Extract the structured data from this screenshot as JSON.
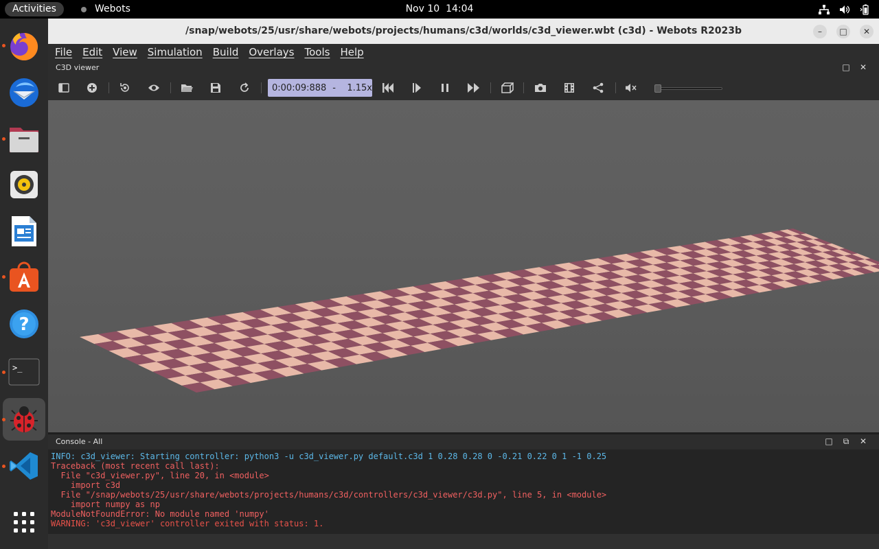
{
  "topbar": {
    "activities": "Activities",
    "app_name": "Webots",
    "date": "Nov 10",
    "time": "14:04"
  },
  "dock": {
    "items": [
      {
        "name": "firefox",
        "running": true
      },
      {
        "name": "thunderbird",
        "running": false
      },
      {
        "name": "files",
        "running": true
      },
      {
        "name": "rhythmbox",
        "running": false
      },
      {
        "name": "libreoffice-writer",
        "running": false
      },
      {
        "name": "app-center",
        "running": true
      },
      {
        "name": "help",
        "running": false
      },
      {
        "name": "terminal",
        "running": true
      },
      {
        "name": "webots",
        "running": true,
        "active": true
      },
      {
        "name": "vscode",
        "running": true
      },
      {
        "name": "show-apps",
        "running": false
      }
    ]
  },
  "window": {
    "title": "/snap/webots/25/usr/share/webots/projects/humans/c3d/worlds/c3d_viewer.wbt (c3d) - Webots R2023b",
    "menu": [
      "File",
      "Edit",
      "View",
      "Simulation",
      "Build",
      "Overlays",
      "Tools",
      "Help"
    ],
    "panel_title": "C3D viewer",
    "toolbar": {
      "time": "0:00:09:888",
      "dash": "-",
      "speed": "1.15x",
      "volume_level": 0
    },
    "console_title": "Console - All",
    "console_lines": [
      {
        "type": "info",
        "text": "INFO: c3d_viewer: Starting controller: python3 -u c3d_viewer.py default.c3d 1 0.28 0.28 0 -0.21 0.22 0 1 -1 0.25"
      },
      {
        "type": "err",
        "text": "Traceback (most recent call last):"
      },
      {
        "type": "err",
        "text": "  File \"c3d_viewer.py\", line 20, in <module>"
      },
      {
        "type": "err",
        "text": "    import c3d"
      },
      {
        "type": "err",
        "text": "  File \"/snap/webots/25/usr/share/webots/projects/humans/c3d/controllers/c3d_viewer/c3d.py\", line 5, in <module>"
      },
      {
        "type": "err",
        "text": "    import numpy as np"
      },
      {
        "type": "err",
        "text": "ModuleNotFoundError: No module named 'numpy'"
      },
      {
        "type": "warn",
        "text": "WARNING: 'c3d_viewer' controller exited with status: 1."
      }
    ]
  },
  "colors": {
    "checker_dark": "#8e5062",
    "checker_light": "#e8b9a8",
    "accent": "#e95420"
  }
}
